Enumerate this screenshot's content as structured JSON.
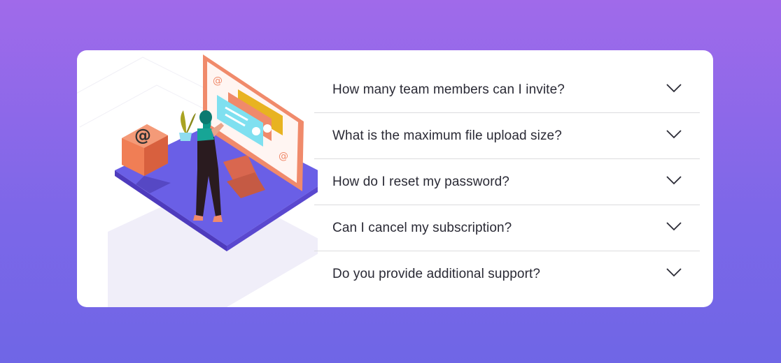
{
  "faq": {
    "items": [
      {
        "question": "How many team members can I invite?"
      },
      {
        "question": "What is the maximum file upload size?"
      },
      {
        "question": "How do I reset my password?"
      },
      {
        "question": "Can I cancel my subscription?"
      },
      {
        "question": "Do you provide additional support?"
      }
    ],
    "expand_icon": "chevron-down-icon"
  },
  "colors": {
    "background_top": "#a06aea",
    "background_bottom": "#6f66e6",
    "platform": "#6a5fe6",
    "monitor_frame": "#f08a6b",
    "cube": "#f07e55"
  }
}
